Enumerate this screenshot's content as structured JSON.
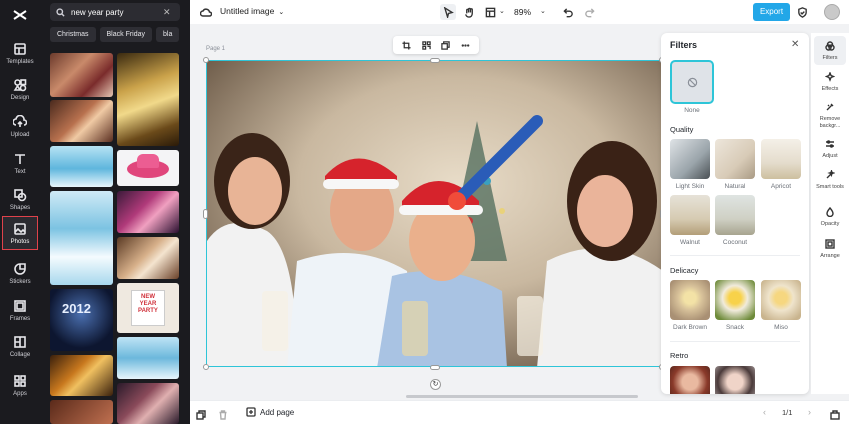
{
  "rail": {
    "items": [
      {
        "label": "Templates",
        "icon": "templates-icon"
      },
      {
        "label": "Design",
        "icon": "design-icon"
      },
      {
        "label": "Upload",
        "icon": "upload-icon"
      },
      {
        "label": "Text",
        "icon": "text-icon"
      },
      {
        "label": "Shapes",
        "icon": "shapes-icon"
      },
      {
        "label": "Photos",
        "icon": "photos-icon",
        "active": true
      },
      {
        "label": "Stickers",
        "icon": "stickers-icon"
      },
      {
        "label": "Frames",
        "icon": "frames-icon"
      },
      {
        "label": "Collage",
        "icon": "collage-icon"
      },
      {
        "label": "Apps",
        "icon": "apps-icon"
      }
    ]
  },
  "search": {
    "value": "new year party"
  },
  "chips": [
    "Christmas",
    "Black Friday",
    "bla"
  ],
  "topbar": {
    "title": "Untitled image",
    "zoom": "89%",
    "export_label": "Export"
  },
  "canvas": {
    "page_label": "Page 1"
  },
  "filters": {
    "title": "Filters",
    "none_label": "None",
    "sections": [
      {
        "name": "Quality",
        "items": [
          "Light Skin",
          "Natural",
          "Apricot",
          "Walnut",
          "Coconut"
        ]
      },
      {
        "name": "Delicacy",
        "items": [
          "Dark Brown",
          "Snack",
          "Miso"
        ]
      },
      {
        "name": "Retro",
        "items": []
      }
    ]
  },
  "props": {
    "items": [
      {
        "label": "Filters",
        "icon": "filters-icon",
        "active": true
      },
      {
        "label": "Effects",
        "icon": "effects-icon"
      },
      {
        "label": "Remove backgr...",
        "icon": "remove-background-icon"
      },
      {
        "label": "Adjust",
        "icon": "adjust-icon"
      },
      {
        "label": "Smart tools",
        "icon": "smart-tools-icon"
      },
      {
        "label": "Opacity",
        "icon": "opacity-icon"
      },
      {
        "label": "Arrange",
        "icon": "arrange-icon"
      }
    ]
  },
  "bottombar": {
    "add_page": "Add page",
    "pager": "1/1"
  },
  "colors": {
    "accent": "#22a7e8",
    "selection": "#2ec5d8",
    "rail_bg": "#1b1b1f",
    "active_outline": "#e0424b"
  }
}
